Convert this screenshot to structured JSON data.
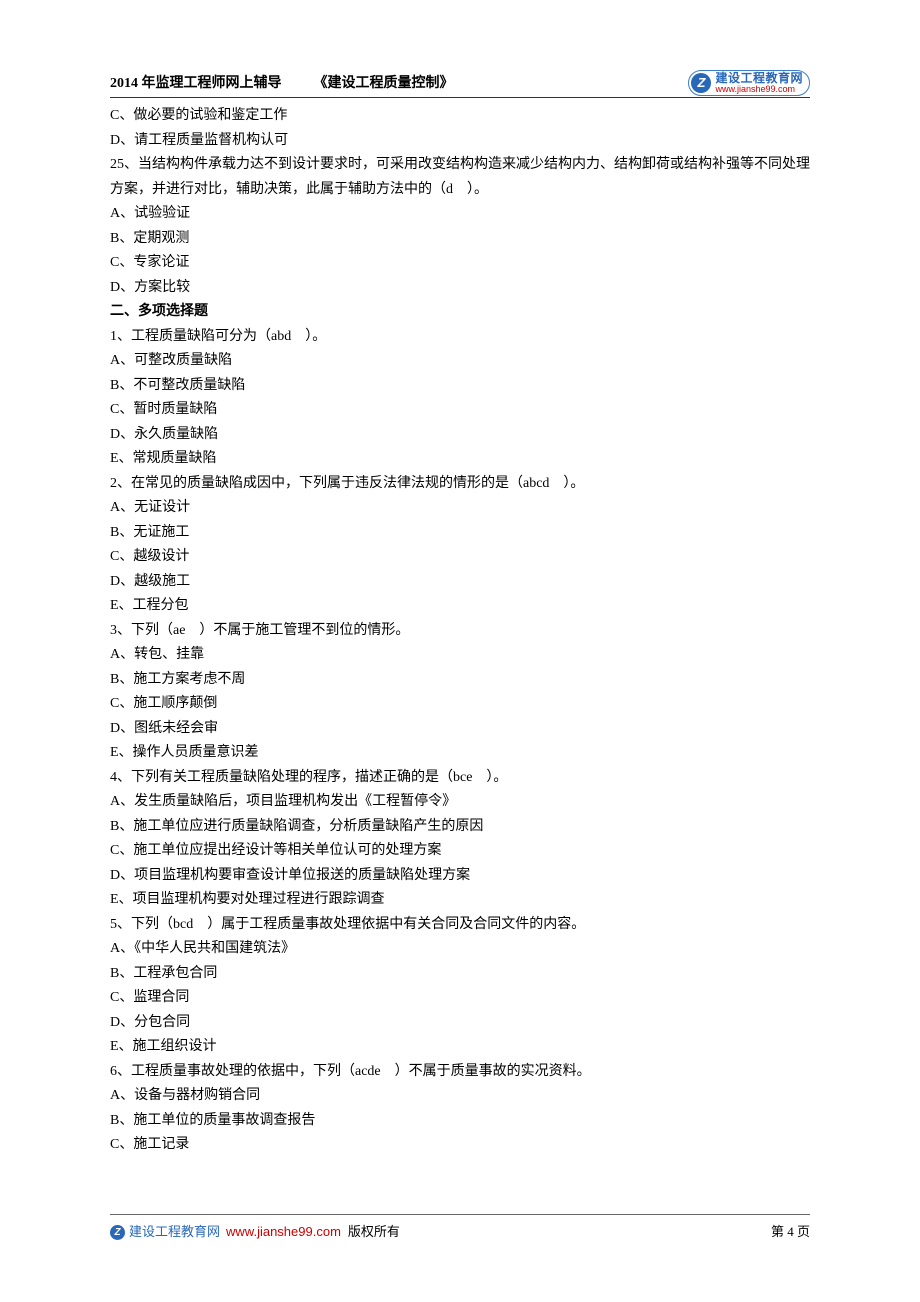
{
  "header": {
    "year_title": "2014 年监理工程师网上辅导",
    "book_title": "《建设工程质量控制》",
    "logo_letter": "Z",
    "logo_top": "建设工程教育网",
    "logo_bottom": "www.jianshe99.com"
  },
  "lines": [
    "C、做必要的试验和鉴定工作",
    "D、请工程质量监督机构认可",
    "25、当结构构件承载力达不到设计要求时，可采用改变结构构造来减少结构内力、结构卸荷或结构补强等不同处理方案，并进行对比，辅助决策，此属于辅助方法中的（d ）。",
    "A、试验验证",
    "B、定期观测",
    "C、专家论证",
    "D、方案比较"
  ],
  "section_title": "二、多项选择题",
  "lines2": [
    "1、工程质量缺陷可分为（abd ）。",
    "A、可整改质量缺陷",
    "B、不可整改质量缺陷",
    "C、暂时质量缺陷",
    "D、永久质量缺陷",
    "E、常规质量缺陷",
    "2、在常见的质量缺陷成因中，下列属于违反法律法规的情形的是（abcd ）。",
    "A、无证设计",
    "B、无证施工",
    "C、越级设计",
    "D、越级施工",
    "E、工程分包",
    "3、下列（ae ）不属于施工管理不到位的情形。",
    "A、转包、挂靠",
    "B、施工方案考虑不周",
    "C、施工顺序颠倒",
    "D、图纸未经会审",
    "E、操作人员质量意识差",
    "4、下列有关工程质量缺陷处理的程序，描述正确的是（bce ）。",
    "A、发生质量缺陷后，项目监理机构发出《工程暂停令》",
    "B、施工单位应进行质量缺陷调查，分析质量缺陷产生的原因",
    "C、施工单位应提出经设计等相关单位认可的处理方案",
    "D、项目监理机构要审查设计单位报送的质量缺陷处理方案",
    "E、项目监理机构要对处理过程进行跟踪调查",
    "5、下列（bcd ）属于工程质量事故处理依据中有关合同及合同文件的内容。",
    "A、《中华人民共和国建筑法》",
    "B、工程承包合同",
    "C、监理合同",
    "D、分包合同",
    "E、施工组织设计",
    "6、工程质量事故处理的依据中，下列（acde ）不属于质量事故的实况资料。",
    "A、设备与器材购销合同",
    "B、施工单位的质量事故调查报告",
    "C、施工记录"
  ],
  "footer": {
    "icon_letter": "Z",
    "site": "建设工程教育网",
    "url": "www.jianshe99.com",
    "copyright": "版权所有",
    "page": "第 4 页"
  }
}
